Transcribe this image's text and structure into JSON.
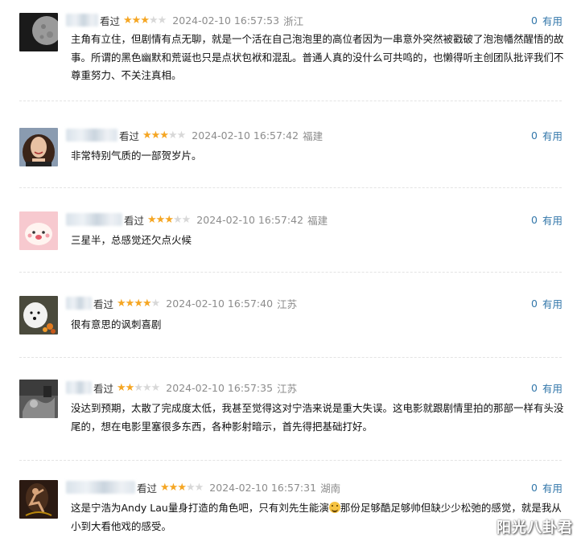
{
  "reviews": [
    {
      "watched": "看过",
      "rating": 3,
      "time": "2024-02-10 16:57:53",
      "location": "浙江",
      "useful_count": "0",
      "useful_label": "有用",
      "content": "主角有立住，但剧情有点无聊，就是一个活在自己泡泡里的高位者因为一串意外突然被戳破了泡泡幡然醒悟的故事。所谓的黑色幽默和荒诞也只是点状包袱和混乱。普通人真的没什么可共鸣的，也懒得听主创团队批评我们不尊重努力、不关注真相。",
      "avatar_icon": "moon-avatar-icon"
    },
    {
      "watched": "看过",
      "rating": 3,
      "time": "2024-02-10 16:57:42",
      "location": "福建",
      "useful_count": "0",
      "useful_label": "有用",
      "content": "非常特别气质的一部贺岁片。",
      "avatar_icon": "woman-portrait-avatar-icon"
    },
    {
      "watched": "看过",
      "rating": 3,
      "time": "2024-02-10 16:57:42",
      "location": "福建",
      "useful_count": "0",
      "useful_label": "有用",
      "content": "三星半，总感觉还欠点火候",
      "avatar_icon": "cartoon-bun-avatar-icon"
    },
    {
      "watched": "看过",
      "rating": 4,
      "time": "2024-02-10 16:57:40",
      "location": "江苏",
      "useful_count": "0",
      "useful_label": "有用",
      "content": "很有意思的讽刺喜剧",
      "avatar_icon": "white-dog-avatar-icon"
    },
    {
      "watched": "看过",
      "rating": 2,
      "time": "2024-02-10 16:57:35",
      "location": "江苏",
      "useful_count": "0",
      "useful_label": "有用",
      "content": "没达到预期，太散了完成度太低，我甚至觉得这对宁浩来说是重大失误。这电影就跟剧情里拍的那部一样有头没尾的，想在电影里塞很多东西，各种影射暗示，首先得把基础打好。",
      "avatar_icon": "dark-gray-photo-avatar-icon"
    },
    {
      "watched": "看过",
      "rating": 3,
      "time": "2024-02-10 16:57:31",
      "location": "湖南",
      "useful_count": "0",
      "useful_label": "有用",
      "content_before": "这是宁浩为Andy Lau量身打造的角色吧，只有刘先生能演",
      "emoji_icon": "grinning-emoji-icon",
      "content_after": "那份足够酷足够帅但缺少少松弛的感觉，就是我从小到大看他戏的感受。",
      "avatar_icon": "dancer-avatar-icon"
    }
  ],
  "watermark": "阳光八卦君",
  "colors": {
    "star_on": "#f5a623",
    "star_off": "#d8d8d8",
    "meta_gray": "#8c8c8c",
    "link_blue": "#3377aa"
  }
}
